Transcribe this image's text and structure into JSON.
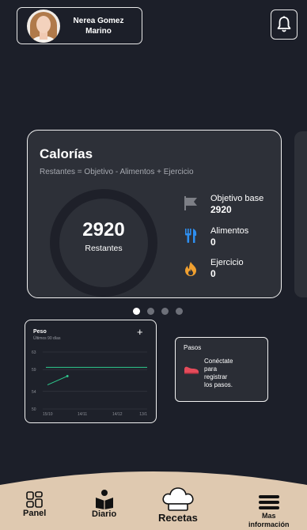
{
  "profile": {
    "name_line1": "Nerea Gomez",
    "name_line2": "Marino"
  },
  "icons": {
    "avatar": "avatar-photo",
    "bell": "bell-icon",
    "flag": "flag-icon",
    "utensils": "fork-knife-icon",
    "exercise": "fire-icon",
    "shoe": "shoe-icon",
    "panel": "dashboard-grid-icon",
    "diario": "book-reader-icon",
    "recetas": "chef-hat-icon",
    "mas": "menu-lines-icon"
  },
  "calories_card": {
    "title": "Calorías",
    "formula": "Restantes = Objetivo - Alimentos + Ejercicio",
    "remaining_value": "2920",
    "remaining_label": "Restantes",
    "stats": [
      {
        "label": "Objetivo base",
        "value": "2920"
      },
      {
        "label": "Alimentos",
        "value": "0"
      },
      {
        "label": "Ejercicio",
        "value": "0"
      }
    ]
  },
  "carousel": {
    "pages": 4,
    "active_index": 0
  },
  "weight_card": {
    "title": "Peso",
    "subtitle": "Últimos 90 días",
    "add_label": "+"
  },
  "chart_data": {
    "type": "line",
    "title": "Peso",
    "subtitle": "Últimos 90 días",
    "x_ticks": [
      "15/10",
      "14/11",
      "14/12",
      "13/1"
    ],
    "y_ticks": [
      63,
      59,
      54,
      50
    ],
    "ylim": [
      50,
      63
    ],
    "grid": true,
    "series": [
      {
        "x": [
          0.0,
          0.2
        ],
        "values": [
          55.5,
          57.5
        ],
        "color": "#2ecc8f"
      }
    ],
    "goal_line": {
      "value": 59.5,
      "color": "#2ecc8f"
    }
  },
  "steps_card": {
    "title": "Pasos",
    "text_line1": "Conéctate",
    "text_line2": "para",
    "text_line3": "registrar",
    "text_line4": "los pasos."
  },
  "bottom_nav": [
    {
      "label": "Panel"
    },
    {
      "label": "Diario"
    },
    {
      "label": "Recetas"
    },
    {
      "label_line1": "Mas",
      "label_line2": "información"
    }
  ],
  "colors": {
    "background": "#1c1f29",
    "card": "#2d3038",
    "nav_bar": "#dfc9b0",
    "flag": "#7d7f86",
    "utensils": "#2e8ff0",
    "exercise": "#f0a030",
    "shoe": "#e54b5a"
  }
}
